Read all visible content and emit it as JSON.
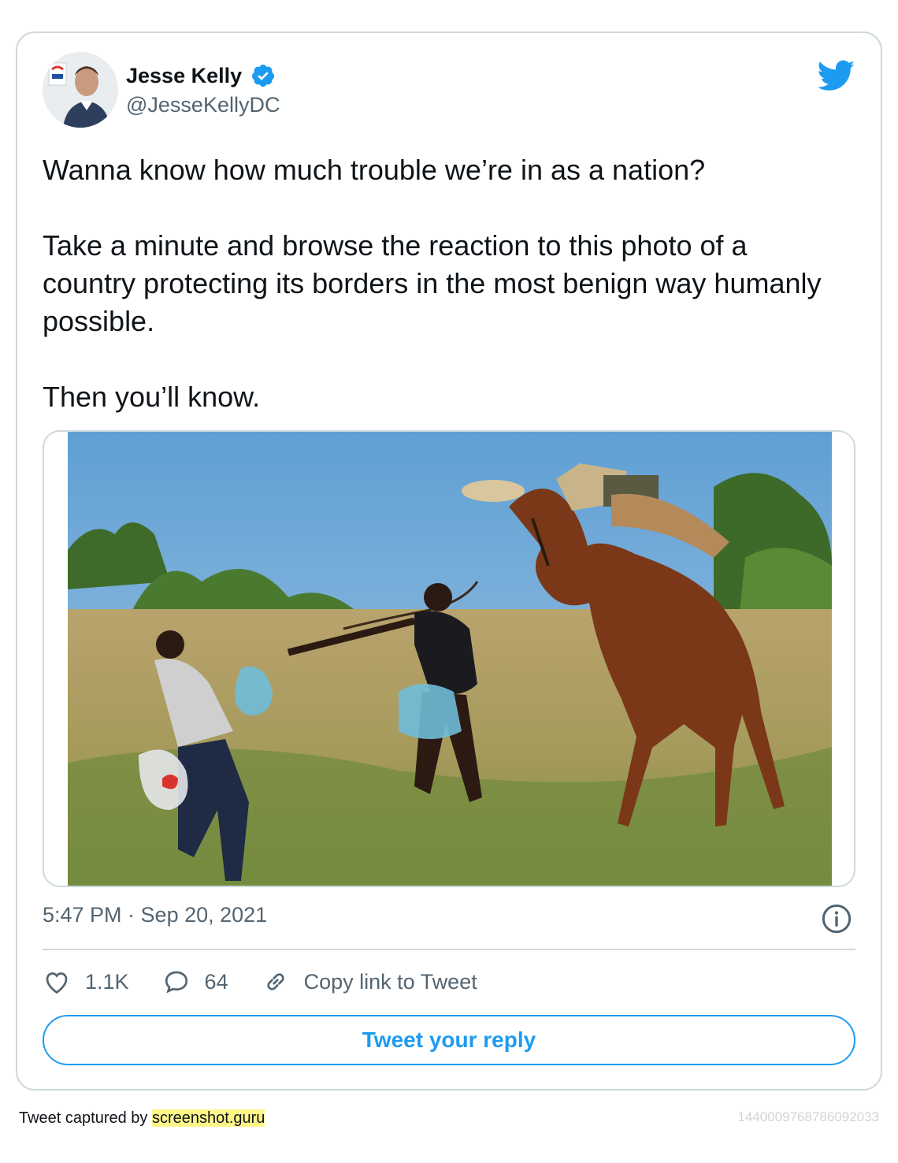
{
  "author": {
    "display_name": "Jesse Kelly",
    "handle": "@JesseKellyDC",
    "verified": true
  },
  "tweet": {
    "paragraphs": [
      "Wanna know how much trouble we’re in as a nation?",
      "Take a minute and browse the reaction to this photo of a country protecting its borders in the most benign way humanly possible.",
      "Then you’ll know."
    ],
    "timestamp": "5:47 PM · Sep 20, 2021"
  },
  "actions": {
    "likes": "1.1K",
    "replies": "64",
    "copy_link_label": "Copy link to Tweet"
  },
  "reply_button_label": "Tweet your reply",
  "footer": {
    "captured_prefix": "Tweet captured by ",
    "captured_link": "screenshot.guru",
    "tweet_id": "1440009768786092033"
  },
  "colors": {
    "accent": "#1d9bf0",
    "muted_text": "#536471",
    "border": "#cfd9de",
    "highlight": "#fff68a"
  },
  "icons": [
    "twitter-bird-icon",
    "verified-badge-icon",
    "info-icon",
    "heart-icon",
    "reply-bubble-icon",
    "link-icon"
  ]
}
